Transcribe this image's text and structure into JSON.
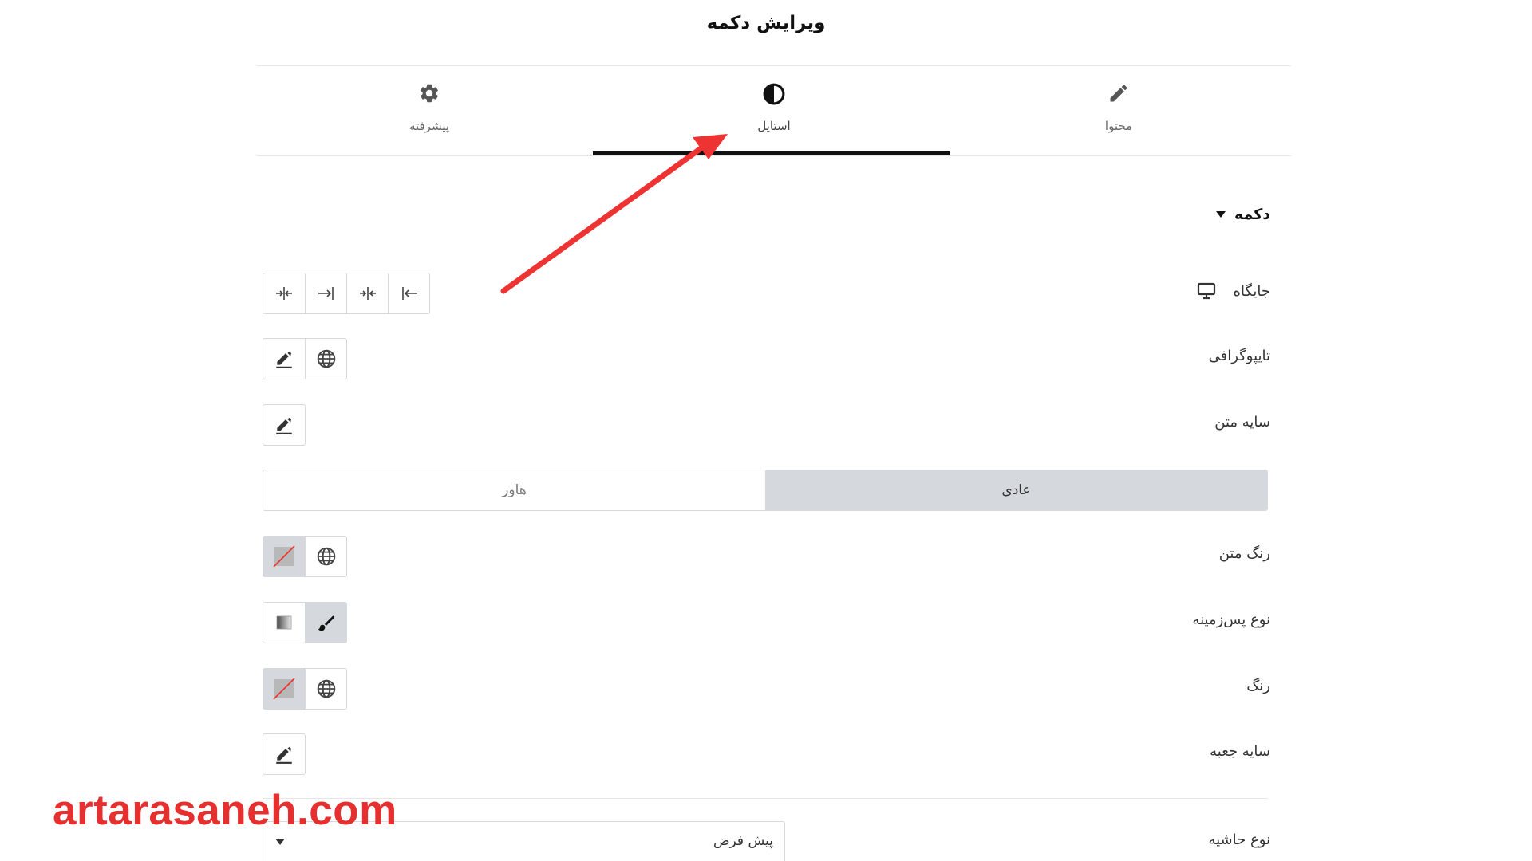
{
  "page": {
    "title": "ویرایش دکمه"
  },
  "tabs": [
    {
      "id": "advanced",
      "label": "پیشرفته",
      "icon": "gear-icon",
      "active": false
    },
    {
      "id": "style",
      "label": "استایل",
      "icon": "contrast-icon",
      "active": true
    },
    {
      "id": "content",
      "label": "محتوا",
      "icon": "pencil-icon",
      "active": false
    }
  ],
  "section": {
    "title": "دکمه"
  },
  "rows": {
    "position": {
      "label": "جایگاه"
    },
    "typography": {
      "label": "تایپوگرافی"
    },
    "text_shadow": {
      "label": "سایه متن"
    },
    "text_color": {
      "label": "رنگ متن"
    },
    "background_type": {
      "label": "نوع پس‌زمینه"
    },
    "color": {
      "label": "رنگ"
    },
    "box_shadow": {
      "label": "سایه جعبه"
    },
    "border_type": {
      "label": "نوع حاشیه",
      "value": "پیش فرض"
    }
  },
  "state_switcher": {
    "normal": "عادی",
    "hover": "هاور"
  },
  "watermark": "artarasaneh.com",
  "colors": {
    "accent": "#111111",
    "arrow": "#ee3333",
    "watermark": "#e63030",
    "control_border": "#d5d8dc",
    "active_fill": "#d5d8dc"
  }
}
